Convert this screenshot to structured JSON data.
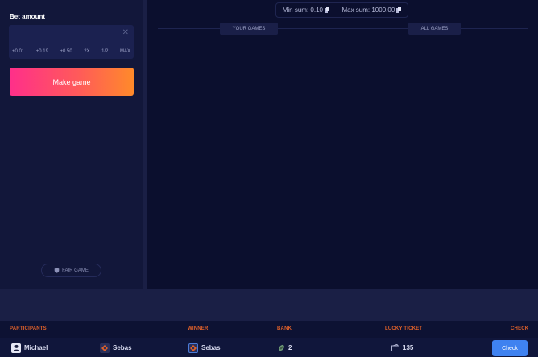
{
  "bet": {
    "title": "Bet amount",
    "input_value": "",
    "input_placeholder": "",
    "quick_buttons": [
      "+0.01",
      "+0.19",
      "+0.50",
      "2X",
      "1/2",
      "MAX"
    ],
    "make_game_label": "Make game"
  },
  "fair_game_label": "FAIR GAME",
  "limits": {
    "min_label": "Min sum: 0.10",
    "max_label": "Max sum: 1000.00"
  },
  "tabs": {
    "your_games": "YOUR GAMES",
    "all_games": "ALL GAMES"
  },
  "history": {
    "headers": {
      "participants": "PARTICIPANTS",
      "winner": "WINNER",
      "bank": "BANK",
      "lucky_ticket": "LUCKY TICKET",
      "check": "CHECK"
    },
    "rows": [
      {
        "participant_1": "Michael",
        "participant_2": "Sebas",
        "winner": "Sebas",
        "bank": "2",
        "lucky_ticket": "135",
        "check_label": "Check"
      }
    ]
  },
  "colors": {
    "accent_orange": "#e0612a",
    "button_gradient_start": "#ff2f8a",
    "button_gradient_end": "#ff8a2a",
    "check_blue": "#3f82f0"
  },
  "icons": {
    "clear": "close-icon",
    "fair": "shield-icon",
    "coin": "coin-icon",
    "bank": "chip-icon",
    "ticket": "ticket-icon"
  }
}
